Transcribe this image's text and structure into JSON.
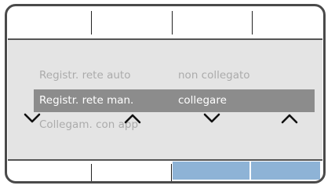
{
  "colors": {
    "panel_bg": "#e4e4e4",
    "selected_row_bg": "#8c8c8c",
    "inactive_text": "#ababab",
    "selected_text": "#ffffff",
    "softkey_active": "#8eb3d6"
  },
  "menu": {
    "items": [
      {
        "label": "Registr. rete auto",
        "value": "non collegato",
        "selected": false
      },
      {
        "label": "Registr. rete man.",
        "value": "collegare",
        "selected": true
      },
      {
        "label": "Collegam. con app",
        "value": "",
        "selected": false
      }
    ]
  },
  "navigation": {
    "arrows": [
      {
        "icon": "chevron-down-icon"
      },
      {
        "icon": "chevron-up-icon"
      },
      {
        "icon": "chevron-down-icon"
      },
      {
        "icon": "chevron-up-icon"
      }
    ]
  },
  "softkeys_bottom": [
    {
      "active": false
    },
    {
      "active": false
    },
    {
      "active": true
    },
    {
      "active": true
    }
  ]
}
